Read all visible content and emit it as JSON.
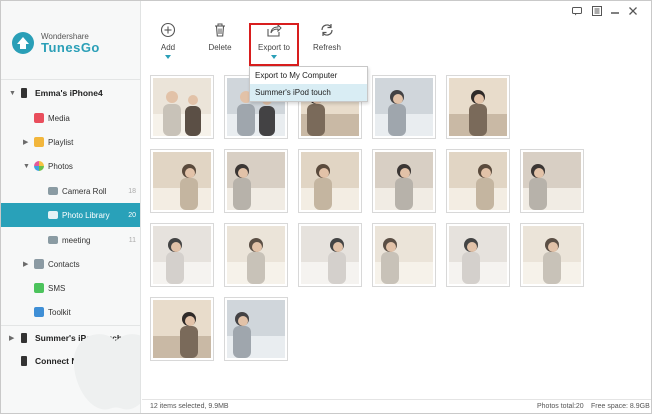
{
  "app": {
    "brand": "Wondershare",
    "name": "TunesGo",
    "accent": "#29a1b9"
  },
  "sidebar": {
    "device1": "Emma's iPhone4",
    "items": [
      {
        "label": "Media",
        "count": ""
      },
      {
        "label": "Playlist",
        "count": ""
      },
      {
        "label": "Photos",
        "count": ""
      },
      {
        "label": "Camera Roll",
        "count": "18"
      },
      {
        "label": "Photo Library",
        "count": "20"
      },
      {
        "label": "meeting",
        "count": "11"
      },
      {
        "label": "Contacts",
        "count": ""
      },
      {
        "label": "SMS",
        "count": ""
      },
      {
        "label": "Toolkit",
        "count": ""
      }
    ],
    "device2": "Summer's iPod touch",
    "connect": "Connect New Device"
  },
  "toolbar": {
    "add": "Add",
    "delete": "Delete",
    "export": "Export to",
    "refresh": "Refresh"
  },
  "export_menu": {
    "items": [
      "Export to My Computer",
      "Summer's iPod touch"
    ]
  },
  "status": {
    "selected": "12 items selected, 9.9MB",
    "total": "Photos total:20",
    "free": "Free space: 8.9GB"
  }
}
